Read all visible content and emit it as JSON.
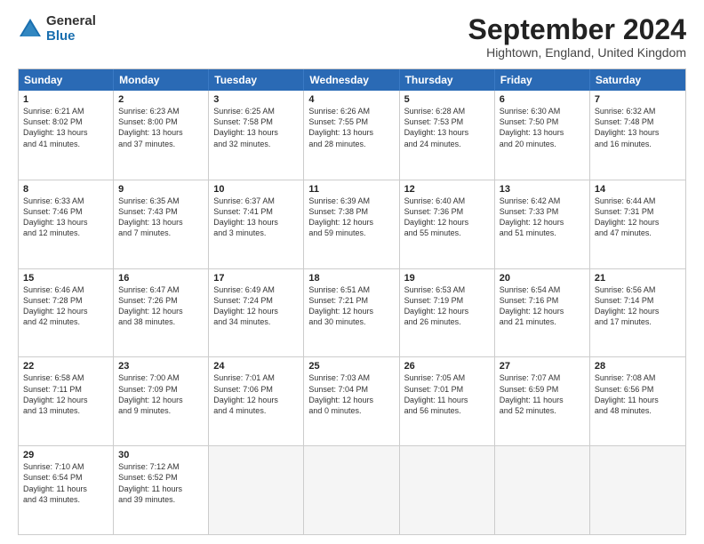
{
  "logo": {
    "general": "General",
    "blue": "Blue"
  },
  "title": "September 2024",
  "location": "Hightown, England, United Kingdom",
  "weekdays": [
    "Sunday",
    "Monday",
    "Tuesday",
    "Wednesday",
    "Thursday",
    "Friday",
    "Saturday"
  ],
  "rows": [
    [
      {
        "num": "1",
        "lines": [
          "Sunrise: 6:21 AM",
          "Sunset: 8:02 PM",
          "Daylight: 13 hours",
          "and 41 minutes."
        ]
      },
      {
        "num": "2",
        "lines": [
          "Sunrise: 6:23 AM",
          "Sunset: 8:00 PM",
          "Daylight: 13 hours",
          "and 37 minutes."
        ]
      },
      {
        "num": "3",
        "lines": [
          "Sunrise: 6:25 AM",
          "Sunset: 7:58 PM",
          "Daylight: 13 hours",
          "and 32 minutes."
        ]
      },
      {
        "num": "4",
        "lines": [
          "Sunrise: 6:26 AM",
          "Sunset: 7:55 PM",
          "Daylight: 13 hours",
          "and 28 minutes."
        ]
      },
      {
        "num": "5",
        "lines": [
          "Sunrise: 6:28 AM",
          "Sunset: 7:53 PM",
          "Daylight: 13 hours",
          "and 24 minutes."
        ]
      },
      {
        "num": "6",
        "lines": [
          "Sunrise: 6:30 AM",
          "Sunset: 7:50 PM",
          "Daylight: 13 hours",
          "and 20 minutes."
        ]
      },
      {
        "num": "7",
        "lines": [
          "Sunrise: 6:32 AM",
          "Sunset: 7:48 PM",
          "Daylight: 13 hours",
          "and 16 minutes."
        ]
      }
    ],
    [
      {
        "num": "8",
        "lines": [
          "Sunrise: 6:33 AM",
          "Sunset: 7:46 PM",
          "Daylight: 13 hours",
          "and 12 minutes."
        ]
      },
      {
        "num": "9",
        "lines": [
          "Sunrise: 6:35 AM",
          "Sunset: 7:43 PM",
          "Daylight: 13 hours",
          "and 7 minutes."
        ]
      },
      {
        "num": "10",
        "lines": [
          "Sunrise: 6:37 AM",
          "Sunset: 7:41 PM",
          "Daylight: 13 hours",
          "and 3 minutes."
        ]
      },
      {
        "num": "11",
        "lines": [
          "Sunrise: 6:39 AM",
          "Sunset: 7:38 PM",
          "Daylight: 12 hours",
          "and 59 minutes."
        ]
      },
      {
        "num": "12",
        "lines": [
          "Sunrise: 6:40 AM",
          "Sunset: 7:36 PM",
          "Daylight: 12 hours",
          "and 55 minutes."
        ]
      },
      {
        "num": "13",
        "lines": [
          "Sunrise: 6:42 AM",
          "Sunset: 7:33 PM",
          "Daylight: 12 hours",
          "and 51 minutes."
        ]
      },
      {
        "num": "14",
        "lines": [
          "Sunrise: 6:44 AM",
          "Sunset: 7:31 PM",
          "Daylight: 12 hours",
          "and 47 minutes."
        ]
      }
    ],
    [
      {
        "num": "15",
        "lines": [
          "Sunrise: 6:46 AM",
          "Sunset: 7:28 PM",
          "Daylight: 12 hours",
          "and 42 minutes."
        ]
      },
      {
        "num": "16",
        "lines": [
          "Sunrise: 6:47 AM",
          "Sunset: 7:26 PM",
          "Daylight: 12 hours",
          "and 38 minutes."
        ]
      },
      {
        "num": "17",
        "lines": [
          "Sunrise: 6:49 AM",
          "Sunset: 7:24 PM",
          "Daylight: 12 hours",
          "and 34 minutes."
        ]
      },
      {
        "num": "18",
        "lines": [
          "Sunrise: 6:51 AM",
          "Sunset: 7:21 PM",
          "Daylight: 12 hours",
          "and 30 minutes."
        ]
      },
      {
        "num": "19",
        "lines": [
          "Sunrise: 6:53 AM",
          "Sunset: 7:19 PM",
          "Daylight: 12 hours",
          "and 26 minutes."
        ]
      },
      {
        "num": "20",
        "lines": [
          "Sunrise: 6:54 AM",
          "Sunset: 7:16 PM",
          "Daylight: 12 hours",
          "and 21 minutes."
        ]
      },
      {
        "num": "21",
        "lines": [
          "Sunrise: 6:56 AM",
          "Sunset: 7:14 PM",
          "Daylight: 12 hours",
          "and 17 minutes."
        ]
      }
    ],
    [
      {
        "num": "22",
        "lines": [
          "Sunrise: 6:58 AM",
          "Sunset: 7:11 PM",
          "Daylight: 12 hours",
          "and 13 minutes."
        ]
      },
      {
        "num": "23",
        "lines": [
          "Sunrise: 7:00 AM",
          "Sunset: 7:09 PM",
          "Daylight: 12 hours",
          "and 9 minutes."
        ]
      },
      {
        "num": "24",
        "lines": [
          "Sunrise: 7:01 AM",
          "Sunset: 7:06 PM",
          "Daylight: 12 hours",
          "and 4 minutes."
        ]
      },
      {
        "num": "25",
        "lines": [
          "Sunrise: 7:03 AM",
          "Sunset: 7:04 PM",
          "Daylight: 12 hours",
          "and 0 minutes."
        ]
      },
      {
        "num": "26",
        "lines": [
          "Sunrise: 7:05 AM",
          "Sunset: 7:01 PM",
          "Daylight: 11 hours",
          "and 56 minutes."
        ]
      },
      {
        "num": "27",
        "lines": [
          "Sunrise: 7:07 AM",
          "Sunset: 6:59 PM",
          "Daylight: 11 hours",
          "and 52 minutes."
        ]
      },
      {
        "num": "28",
        "lines": [
          "Sunrise: 7:08 AM",
          "Sunset: 6:56 PM",
          "Daylight: 11 hours",
          "and 48 minutes."
        ]
      }
    ],
    [
      {
        "num": "29",
        "lines": [
          "Sunrise: 7:10 AM",
          "Sunset: 6:54 PM",
          "Daylight: 11 hours",
          "and 43 minutes."
        ]
      },
      {
        "num": "30",
        "lines": [
          "Sunrise: 7:12 AM",
          "Sunset: 6:52 PM",
          "Daylight: 11 hours",
          "and 39 minutes."
        ]
      },
      {
        "num": "",
        "lines": [],
        "empty": true
      },
      {
        "num": "",
        "lines": [],
        "empty": true
      },
      {
        "num": "",
        "lines": [],
        "empty": true
      },
      {
        "num": "",
        "lines": [],
        "empty": true
      },
      {
        "num": "",
        "lines": [],
        "empty": true
      }
    ]
  ]
}
